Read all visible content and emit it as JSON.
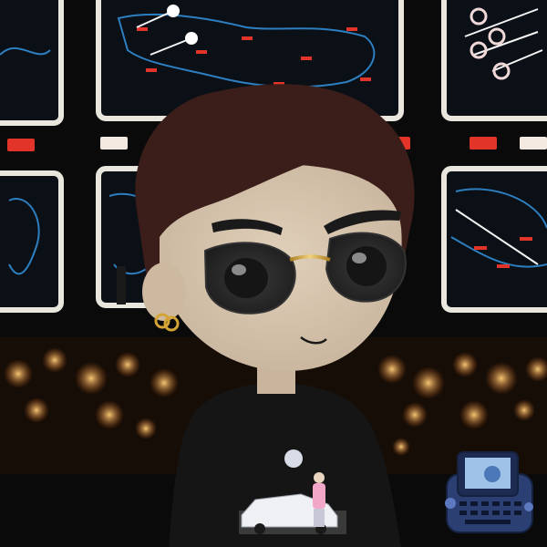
{
  "image": {
    "subject": "avatar-character",
    "background": "control-room-map-screens"
  },
  "colors": {
    "background": "#0a0a0a",
    "screen_frame": "#e9e6de",
    "screen_inner": "#0b0f16",
    "map_blue": "#2d7fc0",
    "map_red": "#e3342a",
    "hair": "#3b1e1a",
    "skin": "#d8c6b0",
    "lens": "#2b2b2b",
    "gold": "#d4a437",
    "shirt": "#151515",
    "phone": "#2b3f72",
    "lights": "#e59a2b"
  }
}
